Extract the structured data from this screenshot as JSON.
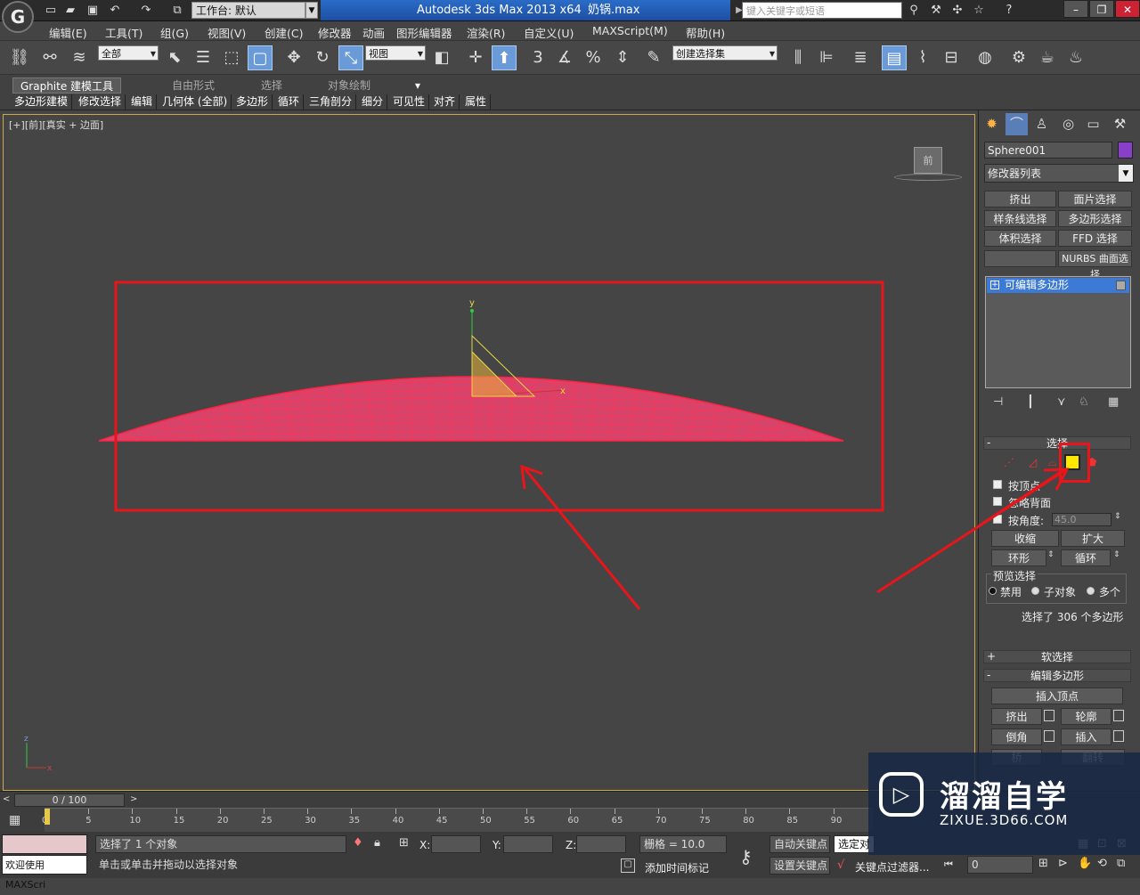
{
  "titlebar": {
    "workspace_label": "工作台: 默认",
    "app_title": "Autodesk 3ds Max  2013 x64",
    "file_name": "奶锅.max",
    "search_placeholder": "键入关键字或短语"
  },
  "menu": [
    "编辑(E)",
    "工具(T)",
    "组(G)",
    "视图(V)",
    "创建(C)",
    "修改器",
    "动画",
    "图形编辑器",
    "渲染(R)",
    "自定义(U)",
    "MAXScript(M)",
    "帮助(H)"
  ],
  "toolbar": {
    "selection_filter": "全部",
    "reference_coord": "视图",
    "named_selection": "创建选择集",
    "snap_label_3": "3",
    "percent_snap": "%"
  },
  "ribbon": {
    "tabs": [
      "Graphite 建模工具",
      "自由形式",
      "选择",
      "对象绘制"
    ],
    "panels": [
      "多边形建模",
      "修改选择",
      "编辑",
      "几何体 (全部)",
      "多边形",
      "循环",
      "三角剖分",
      "细分",
      "可见性",
      "对齐",
      "属性"
    ]
  },
  "viewport": {
    "label_parts": [
      "[+]",
      "[前]",
      "[真实 + 边面]"
    ],
    "viewcube_label": "前",
    "axis_y": "y",
    "axis_x": "x",
    "tripod_z": "z",
    "tripod_x": "x"
  },
  "command_panel": {
    "object_name": "Sphere001",
    "object_color": "#8a3fc8",
    "modifier_list_label": "修改器列表",
    "modifier_buttons": [
      [
        "挤出",
        "面片选择"
      ],
      [
        "样条线选择",
        "多边形选择"
      ],
      [
        "体积选择",
        "FFD 选择"
      ],
      [
        "",
        "NURBS 曲面选择"
      ]
    ],
    "stack_item": "可编辑多边形",
    "selection_rollout": {
      "title": "选择",
      "checkboxes": [
        "按顶点",
        "忽略背面",
        "按角度:"
      ],
      "angle_value": "45.0",
      "shrink": "收缩",
      "grow": "扩大",
      "ring": "环形",
      "loop": "循环",
      "preview_group": "预览选择",
      "preview_options": [
        "禁用",
        "子对象",
        "多个"
      ],
      "status": "选择了 306 个多边形"
    },
    "soft_selection": "软选择",
    "edit_polygons": "编辑多边形",
    "insert_vertex": "插入顶点",
    "edit_buttons": [
      [
        "挤出",
        "轮廓"
      ],
      [
        "倒角",
        "插入"
      ],
      [
        "桥",
        "翻转"
      ]
    ]
  },
  "timeline": {
    "frame_counter": "0 / 100",
    "ticks": [
      "0",
      "5",
      "10",
      "15",
      "20",
      "25",
      "30",
      "35",
      "40",
      "45",
      "50",
      "55",
      "60",
      "65",
      "70",
      "75",
      "80",
      "85",
      "90"
    ]
  },
  "statusbar": {
    "maxscript_welcome": "欢迎使用 MAXScri",
    "selection_status": "选择了 1 个对象",
    "prompt": "单击或单击并拖动以选择对象",
    "x_label": "X:",
    "y_label": "Y:",
    "z_label": "Z:",
    "grid": "栅格 = 10.0",
    "add_time_tag": "添加时间标记",
    "auto_key": "自动关键点",
    "set_key": "设置关键点",
    "selected_dropdown": "选定对",
    "key_filters": "关键点过滤器...",
    "current_frame": "0"
  },
  "watermark": {
    "name": "溜溜自学",
    "url": "ZIXUE.3D66.COM"
  },
  "colors": {
    "highlight_red": "#e8151b",
    "mesh_fill": "#d8436a",
    "mesh_wire": "#ff2244",
    "gizmo_yellow": "#e8d84a",
    "selected_icon": "#ffe800"
  }
}
